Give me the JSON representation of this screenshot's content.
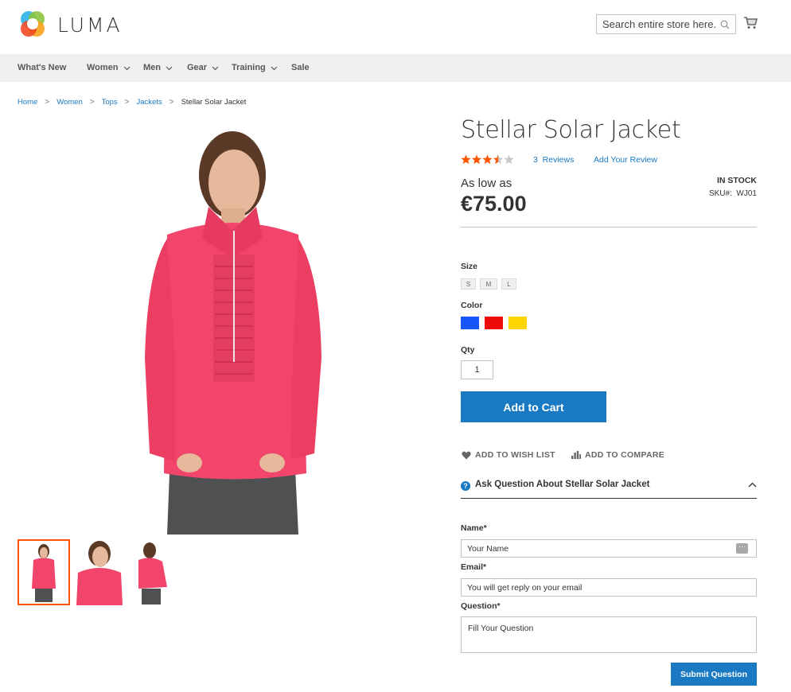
{
  "header": {
    "logo_text": "LUMA",
    "search_placeholder": "Search entire store here...",
    "cart_icon": "cart-icon",
    "search_icon": "magnifier-icon"
  },
  "nav": {
    "items": [
      {
        "label": "What's New",
        "has_dropdown": false
      },
      {
        "label": "Women",
        "has_dropdown": true
      },
      {
        "label": "Men",
        "has_dropdown": true
      },
      {
        "label": "Gear",
        "has_dropdown": true
      },
      {
        "label": "Training",
        "has_dropdown": true
      },
      {
        "label": "Sale",
        "has_dropdown": false
      }
    ]
  },
  "breadcrumbs": [
    "Home",
    "Women",
    "Tops",
    "Jackets",
    "Stellar Solar Jacket"
  ],
  "product": {
    "title": "Stellar Solar Jacket",
    "rating_stars": 3.5,
    "rating_max": 5,
    "reviews_label": "3  Reviews",
    "add_review_label": "Add Your Review",
    "as_low_as": "As low as",
    "price": "€75.00",
    "stock": "IN STOCK",
    "sku": "SKU#:  WJ01"
  },
  "options": {
    "size_label": "Size",
    "sizes": [
      "S",
      "M",
      "L"
    ],
    "color_label": "Color",
    "colors": [
      "#1857f7",
      "#ef0a0a",
      "#ffd500"
    ],
    "qty_label": "Qty",
    "qty_value": "1",
    "add_to_cart": "Add to Cart"
  },
  "actions": {
    "wishlist": "ADD TO WISH LIST",
    "compare": "ADD TO COMPARE"
  },
  "ask": {
    "title": "Ask Question About Stellar Solar Jacket",
    "name_label": "Name*",
    "name_placeholder": "Your Name",
    "email_label": "Email*",
    "email_placeholder": "You will get reply on your email",
    "question_label": "Question*",
    "question_placeholder": "Fill Your Question",
    "submit": "Submit Question"
  },
  "colors": {
    "accent": "#1979c3",
    "star": "#ff5501",
    "jacket": "#f2456b"
  }
}
